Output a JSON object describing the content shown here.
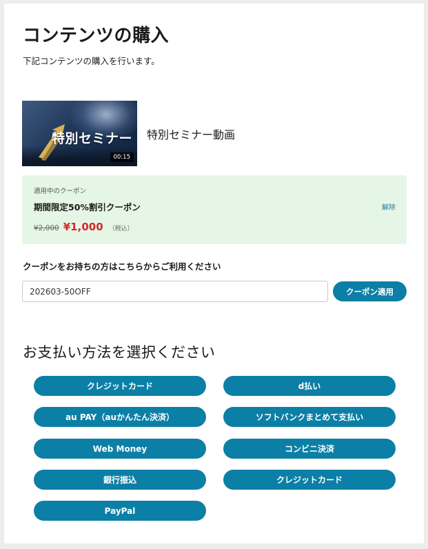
{
  "page": {
    "title": "コンテンツの購入",
    "description": "下記コンテンツの購入を行います。"
  },
  "product": {
    "thumbnail_title": "特別セミナー",
    "duration": "00:15",
    "name": "特別セミナー動画"
  },
  "coupon": {
    "applied_label": "適用中のクーポン",
    "applied_name": "期間限定50%割引クーポン",
    "remove_label": "解除",
    "original_price": "¥2,000",
    "discounted_price": "¥1,000",
    "tax_note": "（税込）",
    "prompt": "クーポンをお持ちの方はこちらからご利用ください",
    "input_value": "202603-50OFF",
    "apply_label": "クーポン適用"
  },
  "payment": {
    "title": "お支払い方法を選択ください",
    "methods": [
      "クレジットカード",
      "d払い",
      "au PAY（auかんたん決済）",
      "ソフトバンクまとめて支払い",
      "Web Money",
      "コンビニ決済",
      "銀行振込",
      "クレジットカード",
      "PayPal"
    ]
  },
  "colors": {
    "accent": "#0c7fa6",
    "coupon_bg": "#e6f6e6",
    "discount_price": "#d02b2b"
  }
}
